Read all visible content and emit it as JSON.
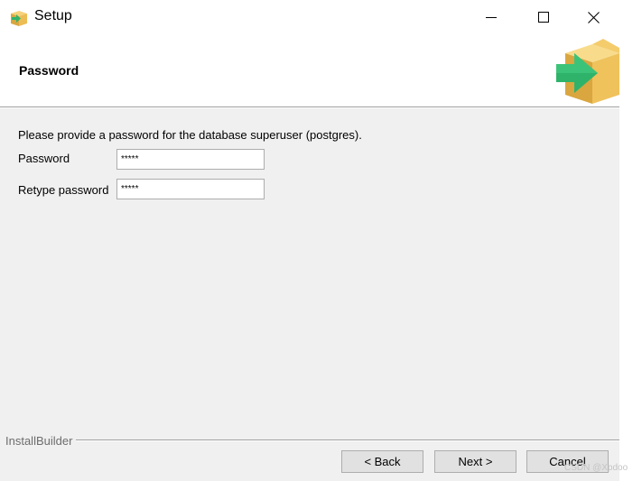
{
  "window": {
    "title": "Setup",
    "app_icon": "setup-box-icon",
    "controls": [
      {
        "name": "minimize-icon"
      },
      {
        "name": "maximize-icon"
      },
      {
        "name": "close-icon"
      }
    ]
  },
  "header": {
    "title": "Password",
    "logo_icon": "box-arrow-logo"
  },
  "content": {
    "intro": "Please provide a password for the database superuser (postgres).",
    "fields": [
      {
        "label": "Password",
        "value": "*****"
      },
      {
        "label": "Retype password",
        "value": "*****"
      }
    ]
  },
  "footer": {
    "brand": "InstallBuilder",
    "buttons": {
      "back": "< Back",
      "next": "Next >",
      "cancel": "Cancel"
    }
  },
  "watermark": "CSDN @Xpdoo",
  "colors": {
    "window_bg": "#f0f0f0",
    "header_bg": "#ffffff",
    "logo_arrow": "#2fb36a",
    "logo_box": "#f0c060"
  }
}
